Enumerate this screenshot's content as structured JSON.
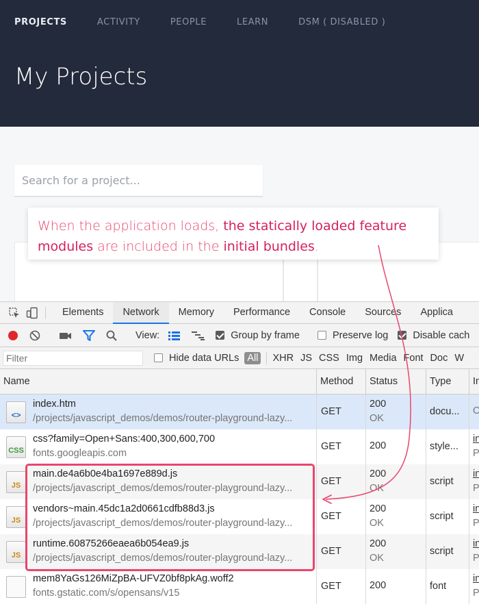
{
  "nav": {
    "items": [
      "PROJECTS",
      "ACTIVITY",
      "PEOPLE",
      "LEARN",
      "DSM ( DISABLED )"
    ],
    "active_index": 0
  },
  "page_title": "My Projects",
  "search": {
    "placeholder": "Search for a project..."
  },
  "callout": {
    "part1": "When the application loads, ",
    "part2": "the statically loaded feature modules",
    "part3": " are included in the ",
    "part4": "initial bundles",
    "part5": "."
  },
  "devtools": {
    "tabs": [
      "Elements",
      "Network",
      "Memory",
      "Performance",
      "Console",
      "Sources",
      "Applica"
    ],
    "active_tab": "Network",
    "toolbar": {
      "view_label": "View:",
      "group_by_frame": {
        "label": "Group by frame",
        "checked": true
      },
      "preserve_log": {
        "label": "Preserve log",
        "checked": false
      },
      "disable_cache": {
        "label": "Disable cach",
        "checked": true
      }
    },
    "filter": {
      "placeholder": "Filter",
      "hide_data_urls": {
        "label": "Hide data URLs",
        "checked": false
      },
      "types": [
        "All",
        "XHR",
        "JS",
        "CSS",
        "Img",
        "Media",
        "Font",
        "Doc",
        "W"
      ]
    },
    "columns": [
      "Name",
      "Method",
      "Status",
      "Type",
      "In"
    ],
    "rows": [
      {
        "icon": "html",
        "icon_text": "<>",
        "name": "index.htm",
        "path": "/projects/javascript_demos/demos/router-playground-lazy...",
        "method": "GET",
        "status": "200",
        "status_text": "OK",
        "type": "docu...",
        "init_a": "",
        "init_b": "O"
      },
      {
        "icon": "css",
        "icon_text": "CSS",
        "name": "css?family=Open+Sans:400,300,600,700",
        "path": "fonts.googleapis.com",
        "method": "GET",
        "status": "200",
        "status_text": "",
        "type": "style...",
        "init_a": "in",
        "init_b": "P"
      },
      {
        "icon": "js",
        "icon_text": "JS",
        "name": "main.de4a6b0e4ba1697e889d.js",
        "path": "/projects/javascript_demos/demos/router-playground-lazy...",
        "method": "GET",
        "status": "200",
        "status_text": "OK",
        "type": "script",
        "init_a": "in",
        "init_b": "P"
      },
      {
        "icon": "js",
        "icon_text": "JS",
        "name": "vendors~main.45dc1a2d0661cdfb88d3.js",
        "path": "/projects/javascript_demos/demos/router-playground-lazy...",
        "method": "GET",
        "status": "200",
        "status_text": "OK",
        "type": "script",
        "init_a": "in",
        "init_b": "P"
      },
      {
        "icon": "js",
        "icon_text": "JS",
        "name": "runtime.60875266eaea6b054ea9.js",
        "path": "/projects/javascript_demos/demos/router-playground-lazy...",
        "method": "GET",
        "status": "200",
        "status_text": "OK",
        "type": "script",
        "init_a": "in",
        "init_b": "P"
      },
      {
        "icon": "blank",
        "icon_text": "",
        "name": "mem8YaGs126MiZpBA-UFVZ0bf8pkAg.woff2",
        "path": "fonts.gstatic.com/s/opensans/v15",
        "method": "GET",
        "status": "200",
        "status_text": "",
        "type": "font",
        "init_a": "in",
        "init_b": "P"
      }
    ]
  },
  "colors": {
    "header_bg": "#232a3b",
    "annotation": "#e8466d",
    "selected_row": "#dbe8f9",
    "tab_underline": "#1a73e8",
    "record_button": "#e0262b"
  }
}
